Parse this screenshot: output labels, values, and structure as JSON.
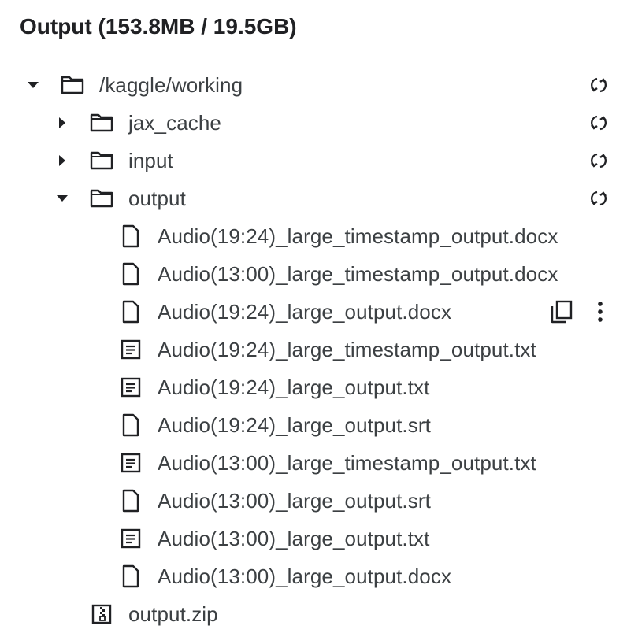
{
  "header": {
    "title": "Output (153.8MB / 19.5GB)"
  },
  "tree": {
    "root": {
      "label": "/kaggle/working",
      "expanded": true,
      "icon": "folder-icon",
      "action": "refresh-icon"
    },
    "folders": [
      {
        "label": "jax_cache",
        "expanded": false,
        "icon": "folder-icon",
        "action": "refresh-icon"
      },
      {
        "label": "input",
        "expanded": false,
        "icon": "folder-icon",
        "action": "refresh-icon"
      },
      {
        "label": "output",
        "expanded": true,
        "icon": "folder-icon",
        "action": "refresh-icon"
      }
    ],
    "output_files": [
      {
        "label": "Audio(19:24)_large_timestamp_output.docx",
        "icon": "file-icon"
      },
      {
        "label": "Audio(13:00)_large_timestamp_output.docx",
        "icon": "file-icon"
      },
      {
        "label": "Audio(19:24)_large_output.docx",
        "icon": "file-icon",
        "hovered": true,
        "hover_actions": [
          "copy-icon",
          "more-vert-icon"
        ]
      },
      {
        "label": "Audio(19:24)_large_timestamp_output.txt",
        "icon": "text-file-icon"
      },
      {
        "label": "Audio(19:24)_large_output.txt",
        "icon": "text-file-icon"
      },
      {
        "label": "Audio(19:24)_large_output.srt",
        "icon": "file-icon"
      },
      {
        "label": "Audio(13:00)_large_timestamp_output.txt",
        "icon": "text-file-icon"
      },
      {
        "label": "Audio(13:00)_large_output.srt",
        "icon": "file-icon"
      },
      {
        "label": "Audio(13:00)_large_output.txt",
        "icon": "text-file-icon"
      },
      {
        "label": "Audio(13:00)_large_output.docx",
        "icon": "file-icon"
      }
    ],
    "root_files": [
      {
        "label": "output.zip",
        "icon": "zip-file-icon"
      }
    ]
  },
  "colors": {
    "text": "#3c4043",
    "title": "#202124",
    "icon": "#202124"
  }
}
